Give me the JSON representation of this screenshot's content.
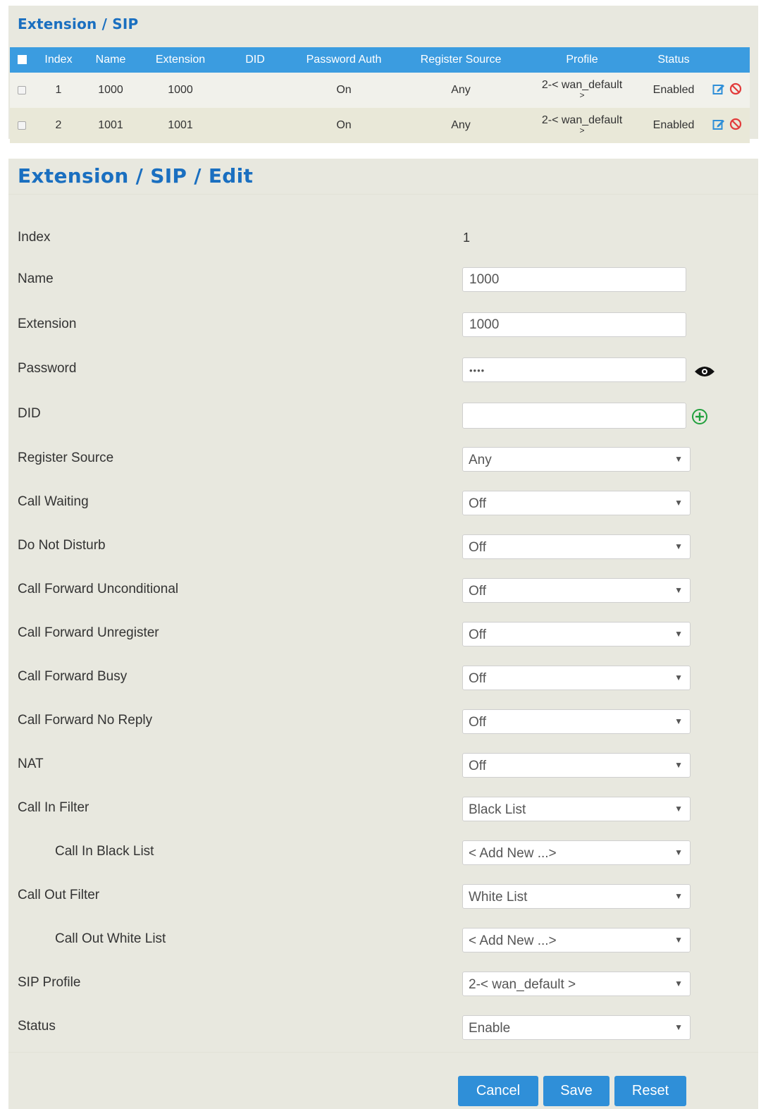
{
  "list": {
    "title": "Extension / SIP",
    "columns": [
      "Index",
      "Name",
      "Extension",
      "DID",
      "Password Auth",
      "Register Source",
      "Profile",
      "Status"
    ],
    "rows": [
      {
        "index": "1",
        "name": "1000",
        "extension": "1000",
        "did": "",
        "password_auth": "On",
        "register_source": "Any",
        "profile_line1": "2-< wan_default",
        "profile_line2": ">",
        "status": "Enabled"
      },
      {
        "index": "2",
        "name": "1001",
        "extension": "1001",
        "did": "",
        "password_auth": "On",
        "register_source": "Any",
        "profile_line1": "2-< wan_default",
        "profile_line2": ">",
        "status": "Enabled"
      }
    ]
  },
  "edit": {
    "title": "Extension / SIP / Edit",
    "index_label": "Index",
    "index_value": "1",
    "name_label": "Name",
    "name_value": "1000",
    "extension_label": "Extension",
    "extension_value": "1000",
    "password_label": "Password",
    "password_value": "••••",
    "did_label": "DID",
    "did_value": "",
    "register_source_label": "Register Source",
    "register_source_value": "Any",
    "call_waiting_label": "Call Waiting",
    "call_waiting_value": "Off",
    "dnd_label": "Do Not Disturb",
    "dnd_value": "Off",
    "cf_unconditional_label": "Call Forward Unconditional",
    "cf_unconditional_value": "Off",
    "cf_unregister_label": "Call Forward Unregister",
    "cf_unregister_value": "Off",
    "cf_busy_label": "Call Forward Busy",
    "cf_busy_value": "Off",
    "cf_noreply_label": "Call Forward No Reply",
    "cf_noreply_value": "Off",
    "nat_label": "NAT",
    "nat_value": "Off",
    "call_in_filter_label": "Call In Filter",
    "call_in_filter_value": "Black List",
    "call_in_black_list_label": "Call In Black List",
    "call_in_black_list_value": "< Add New ...>",
    "call_out_filter_label": "Call Out Filter",
    "call_out_filter_value": "White List",
    "call_out_white_list_label": "Call Out White List",
    "call_out_white_list_value": "< Add New ...>",
    "sip_profile_label": "SIP Profile",
    "sip_profile_value": "2-< wan_default >",
    "status_label": "Status",
    "status_value": "Enable"
  },
  "buttons": {
    "cancel": "Cancel",
    "save": "Save",
    "reset": "Reset"
  },
  "colors": {
    "accent": "#3b9ce0",
    "title": "#1a6fc0",
    "button": "#2f8fd8",
    "panel": "#e8e8df",
    "delete": "#e23b3b",
    "add": "#21a03d"
  },
  "icons": {
    "edit": "edit-icon",
    "delete": "delete-icon",
    "show_password": "eye-icon",
    "add": "plus-circle-icon"
  }
}
